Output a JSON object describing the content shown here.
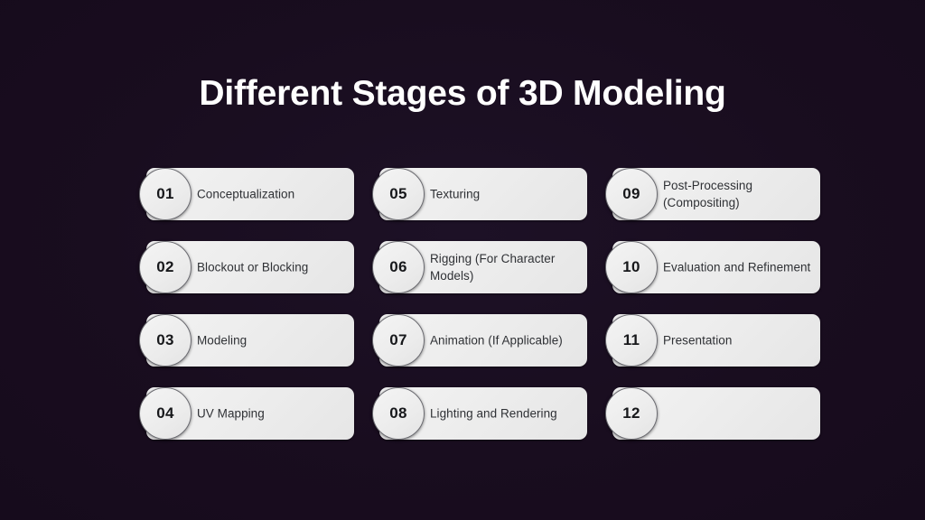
{
  "slide": {
    "title": "Different Stages of 3D Modeling",
    "background_color": "#1a0e20",
    "title_color": "#ffffff",
    "card_color": "#eeeeee",
    "card_text_color": "#2f3135",
    "badge_border_color": "#6a6a70"
  },
  "stages": [
    {
      "number": "01",
      "label": "Conceptualization"
    },
    {
      "number": "02",
      "label": "Blockout or Blocking"
    },
    {
      "number": "03",
      "label": "Modeling"
    },
    {
      "number": "04",
      "label": "UV Mapping"
    },
    {
      "number": "05",
      "label": "Texturing"
    },
    {
      "number": "06",
      "label": "Rigging (For Character Models)"
    },
    {
      "number": "07",
      "label": "Animation (If Applicable)"
    },
    {
      "number": "08",
      "label": "Lighting and Rendering"
    },
    {
      "number": "09",
      "label": "Post-Processing (Compositing)"
    },
    {
      "number": "10",
      "label": "Evaluation and Refinement"
    },
    {
      "number": "11",
      "label": "Presentation"
    },
    {
      "number": "12",
      "label": ""
    }
  ]
}
